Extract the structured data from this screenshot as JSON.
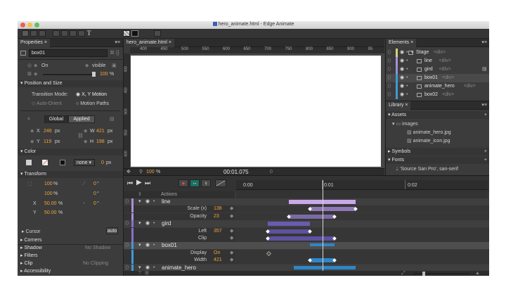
{
  "window": {
    "title": "hero_animate.html - Edge Animate"
  },
  "properties": {
    "tab": "Properties",
    "element_name": "box01",
    "display_label": "On",
    "visibility": "visible",
    "opacity_value": "100",
    "opacity_unit": "%",
    "position_size_title": "Position and Size",
    "transition_mode_label": "Transition Mode:",
    "transition_xy": "X, Y Motion",
    "auto_orient": "Auto-Orient",
    "motion_paths": "Motion Paths",
    "global_btn": "Global",
    "applied_btn": "Applied",
    "x_label": "X",
    "x_value": "246",
    "x_unit": "px",
    "y_label": "Y",
    "y_value": "119",
    "y_unit": "px",
    "w_label": "W",
    "w_value": "421",
    "w_unit": "px",
    "h_label": "H",
    "h_value": "198",
    "h_unit": "px",
    "color_title": "Color",
    "color_select": "none",
    "border_value": "0",
    "border_unit": "px",
    "transform_title": "Transform",
    "scale_x": "100",
    "scale_y": "100",
    "scale_unit": "%",
    "skew_x": "0",
    "skew_y": "0",
    "deg": "°",
    "rotate": "0",
    "origin_x_label": "X",
    "origin_x": "50.00",
    "origin_y_label": "Y",
    "origin_y": "50.00",
    "pct": "%",
    "cursor_title": "Cursor",
    "cursor_value": "auto",
    "corners": "Corners",
    "shadow": "Shadow",
    "shadow_value": "No Shadow",
    "filters": "Filters",
    "clip": "Clip",
    "clip_value": "No Clipping",
    "accessibility": "Accessibility"
  },
  "stage": {
    "tab": "hero_animate.html",
    "ruler_labels": [
      "400",
      "450",
      "500",
      "550",
      "600",
      "650",
      "700",
      "750",
      "800",
      "850",
      "900",
      "95"
    ],
    "vruler_labels": [
      "400",
      "450",
      "500",
      "550",
      "600"
    ],
    "zoom": "100",
    "zoom_unit": "%",
    "time": "00:01.075",
    "small_value": "0"
  },
  "elements": {
    "tab": "Elements",
    "items": [
      {
        "name": "Stage",
        "tag": "<div>"
      },
      {
        "name": "line",
        "tag": "<div>"
      },
      {
        "name": "gird",
        "tag": "<div>"
      },
      {
        "name": "box01",
        "tag": "<div>"
      },
      {
        "name": "animate_hero",
        "tag": "<div>"
      },
      {
        "name": "box02",
        "tag": "<div>"
      }
    ],
    "colors": [
      "#d8d27a",
      "#a98fd6",
      "#9a8ecf",
      "#3f9ad8",
      "#3f9ad8",
      "#3f9ad8"
    ]
  },
  "library": {
    "tab": "Library",
    "assets": "Assets",
    "images": "images",
    "files": [
      "animate_hero.jpg",
      "animate_icon.jpg"
    ],
    "symbols": "Symbols",
    "fonts": "Fonts",
    "font_item": "'Source San Pro', san-serif"
  },
  "timeline": {
    "actions": "Actions",
    "time_labels": [
      "0:00",
      "0:01",
      "0:02"
    ],
    "rows": [
      {
        "name": "line",
        "type": "element"
      },
      {
        "name": "Scale (x)",
        "value": "138",
        "type": "prop"
      },
      {
        "name": "Opacity",
        "value": "23",
        "type": "prop"
      },
      {
        "name": "gird",
        "type": "element"
      },
      {
        "name": "Left",
        "value": "357",
        "type": "prop"
      },
      {
        "name": "Clip",
        "value": "",
        "type": "prop"
      },
      {
        "name": "box01",
        "type": "element"
      },
      {
        "name": "Display",
        "value": "On",
        "type": "prop"
      },
      {
        "name": "Width",
        "value": "421",
        "type": "prop"
      },
      {
        "name": "animate_hero",
        "type": "element"
      }
    ]
  }
}
